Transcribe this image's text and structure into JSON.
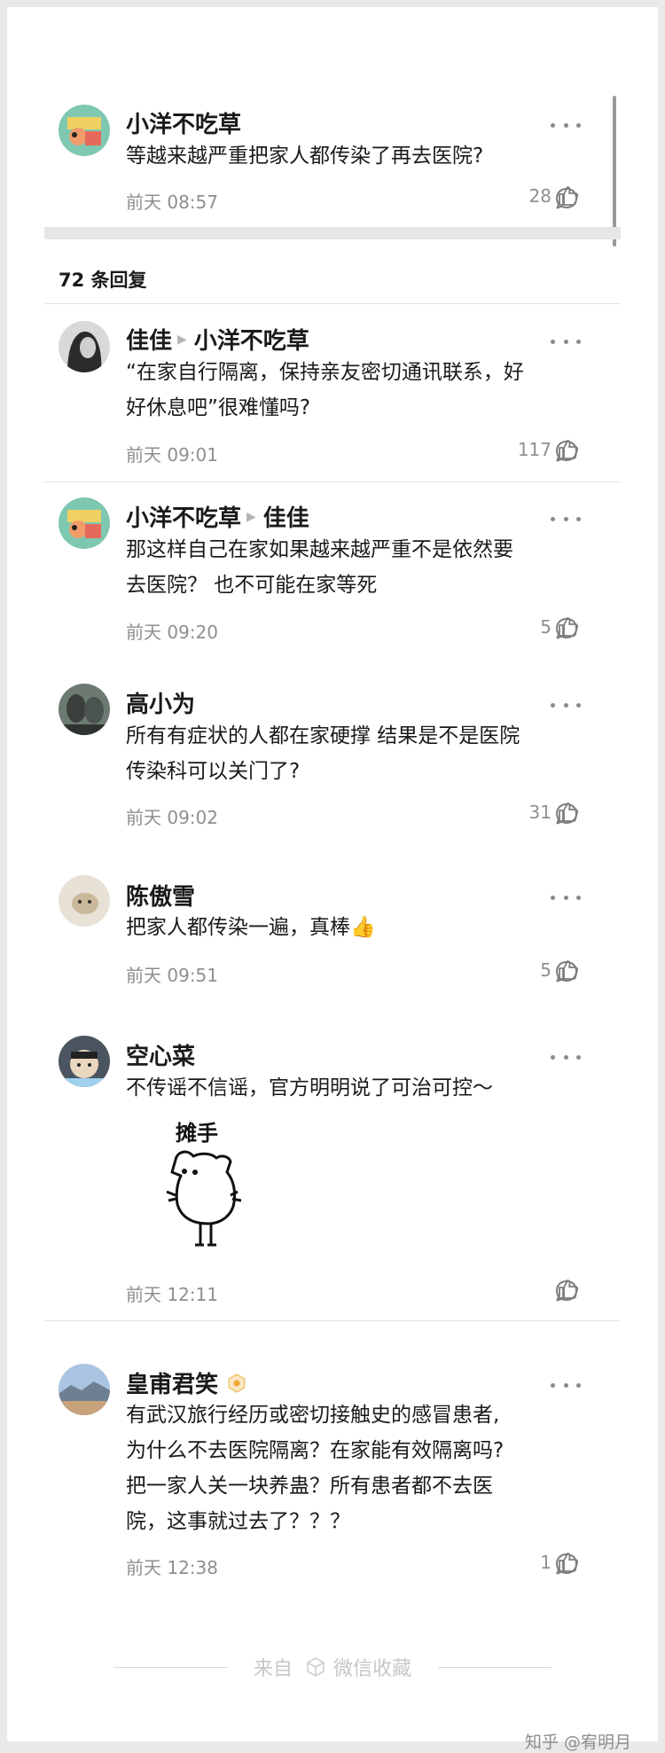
{
  "parent_comment": {
    "author": "小洋不吃草",
    "text": "等越来越严重把家人都传染了再去医院?",
    "time": "前天 08:57",
    "likes": "28"
  },
  "reply_count_label": "72 条回复",
  "replies": [
    {
      "author": "佳佳",
      "reply_to": "小洋不吃草",
      "text_lines": [
        "“在家自行隔离，保持亲友密切通讯联系，好",
        "好休息吧”很难懂吗?"
      ],
      "time": "前天 09:01",
      "likes": "117"
    },
    {
      "author": "小洋不吃草",
      "reply_to": "佳佳",
      "text_lines": [
        "那这样自己在家如果越来越严重不是依然要",
        "去医院？ 也不可能在家等死"
      ],
      "time": "前天 09:20",
      "likes": "5"
    },
    {
      "author": "高小为",
      "text_lines": [
        "所有有症状的人都在家硬撑 结果是不是医院",
        "传染科可以关门了?"
      ],
      "time": "前天 09:02",
      "likes": "31"
    },
    {
      "author": "陈傲雪",
      "text_lines": [
        "把家人都传染一遍，真棒"
      ],
      "emoji": "👍",
      "time": "前天 09:51",
      "likes": "5"
    },
    {
      "author": "空心菜",
      "text_lines": [
        "不传谣不信谣，官方明明说了可治可控～"
      ],
      "sticker_caption": "摊手",
      "time": "前天 12:11",
      "likes": ""
    },
    {
      "author": "皇甫君笑",
      "text_lines": [
        "有武汉旅行经历或密切接触史的感冒患者,",
        "为什么不去医院隔离？在家能有效隔离吗?",
        "把一家人关一块养蛊？所有患者都不去医",
        "院，这事就过去了？？？"
      ],
      "time": "前天 12:38",
      "likes": "1"
    }
  ],
  "footer": {
    "from_label": "来自",
    "source_label": "微信收藏"
  },
  "watermark": "知乎 @宥明月",
  "icons": {
    "more": "more-dots-icon",
    "like": "thumbs-up-icon",
    "reply": "comment-bubble-icon"
  },
  "colors": {
    "text": "#1a1a1a",
    "meta": "#8f8f8f",
    "divider": "#e4e4e4",
    "badge": "#f0c36d"
  }
}
